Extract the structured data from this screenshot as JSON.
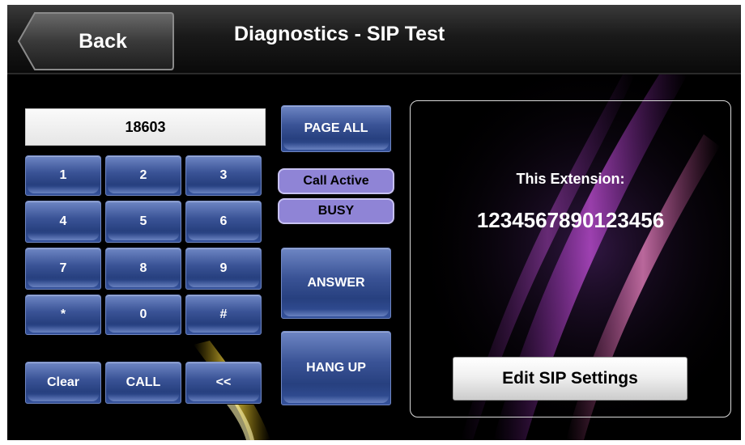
{
  "header": {
    "back_label": "Back",
    "title": "Diagnostics - SIP Test"
  },
  "dialer": {
    "display_value": "18603",
    "keys": [
      "1",
      "2",
      "3",
      "4",
      "5",
      "6",
      "7",
      "8",
      "9",
      "*",
      "0",
      "#"
    ],
    "clear_label": "Clear",
    "call_label": "CALL",
    "backspace_label": "<<"
  },
  "controls": {
    "page_all_label": "PAGE ALL",
    "call_status": "Call Active",
    "line_status": "BUSY",
    "answer_label": "ANSWER",
    "hang_up_label": "HANG UP"
  },
  "info": {
    "extension_label": "This Extension:",
    "extension_number": "1234567890123456",
    "edit_settings_label": "Edit SIP Settings"
  },
  "colors": {
    "key_blue": "#3a5396",
    "status_purple": "#8f84d6",
    "background": "#000000"
  }
}
